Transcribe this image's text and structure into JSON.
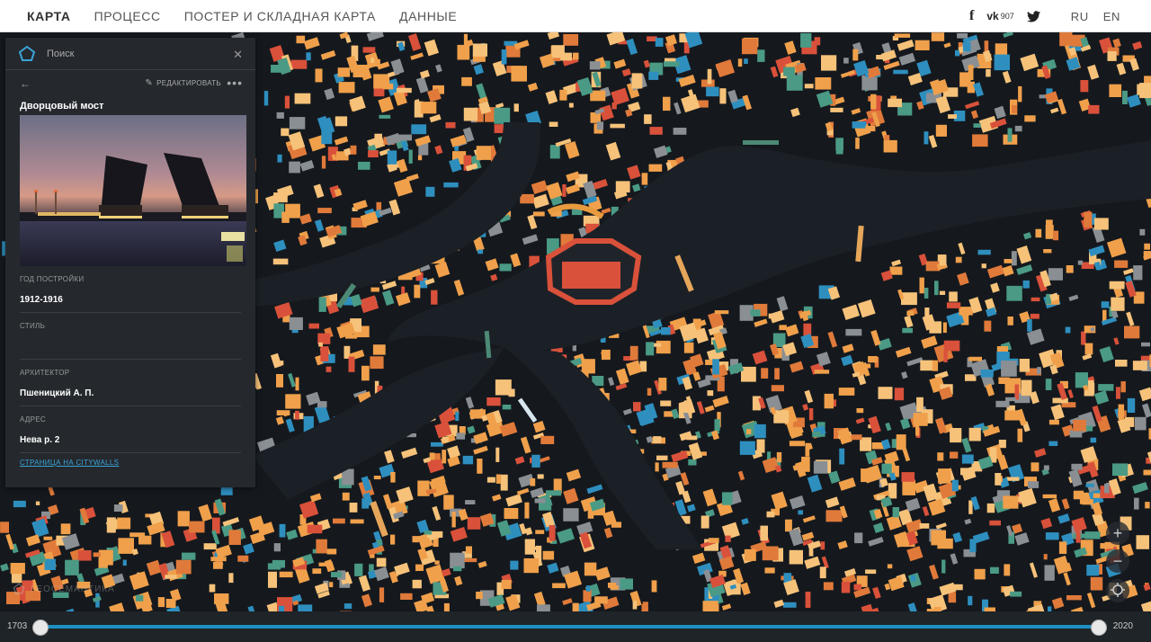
{
  "nav": {
    "items": [
      "КАРТА",
      "ПРОЦЕСС",
      "ПОСТЕР И СКЛАДНАЯ КАРТА",
      "ДАННЫЕ"
    ],
    "active_index": 0
  },
  "social": {
    "facebook_icon": "facebook-icon",
    "vk_label": "vk",
    "vk_count": "907",
    "twitter_icon": "twitter-icon"
  },
  "languages": [
    "RU",
    "EN"
  ],
  "panel": {
    "search_placeholder": "Поиск",
    "edit_label": "РЕДАКТИРОВАТЬ",
    "more_label": "•••",
    "title": "Дворцовый мост",
    "fields": [
      {
        "label": "ГОД ПОСТРОЙКИ",
        "value": "1912-1916"
      },
      {
        "label": "СТИЛЬ",
        "value": ""
      },
      {
        "label": "АРХИТЕКТОР",
        "value": "Пшеницкий А. П."
      },
      {
        "label": "АДРЕС",
        "value": "Нева р.  2"
      }
    ],
    "link_label": "СТРАНИЦА НА CITYWALLS"
  },
  "map": {
    "watermark": "ГЕОСЕМАНТИКА",
    "zoom_in": "+",
    "zoom_out": "−",
    "locate_icon": "crosshair-icon"
  },
  "timeline": {
    "start": "1703",
    "end": "2020"
  },
  "colors": {
    "accent": "#1e90c4",
    "link": "#3aa4d8",
    "panel_bg": "#25292e",
    "building_orange": "#f0a04b",
    "building_light": "#f6c27a",
    "building_red": "#d9513a",
    "building_blue": "#2e8fbf",
    "building_teal": "#4a9a85",
    "water": "#181c22"
  }
}
